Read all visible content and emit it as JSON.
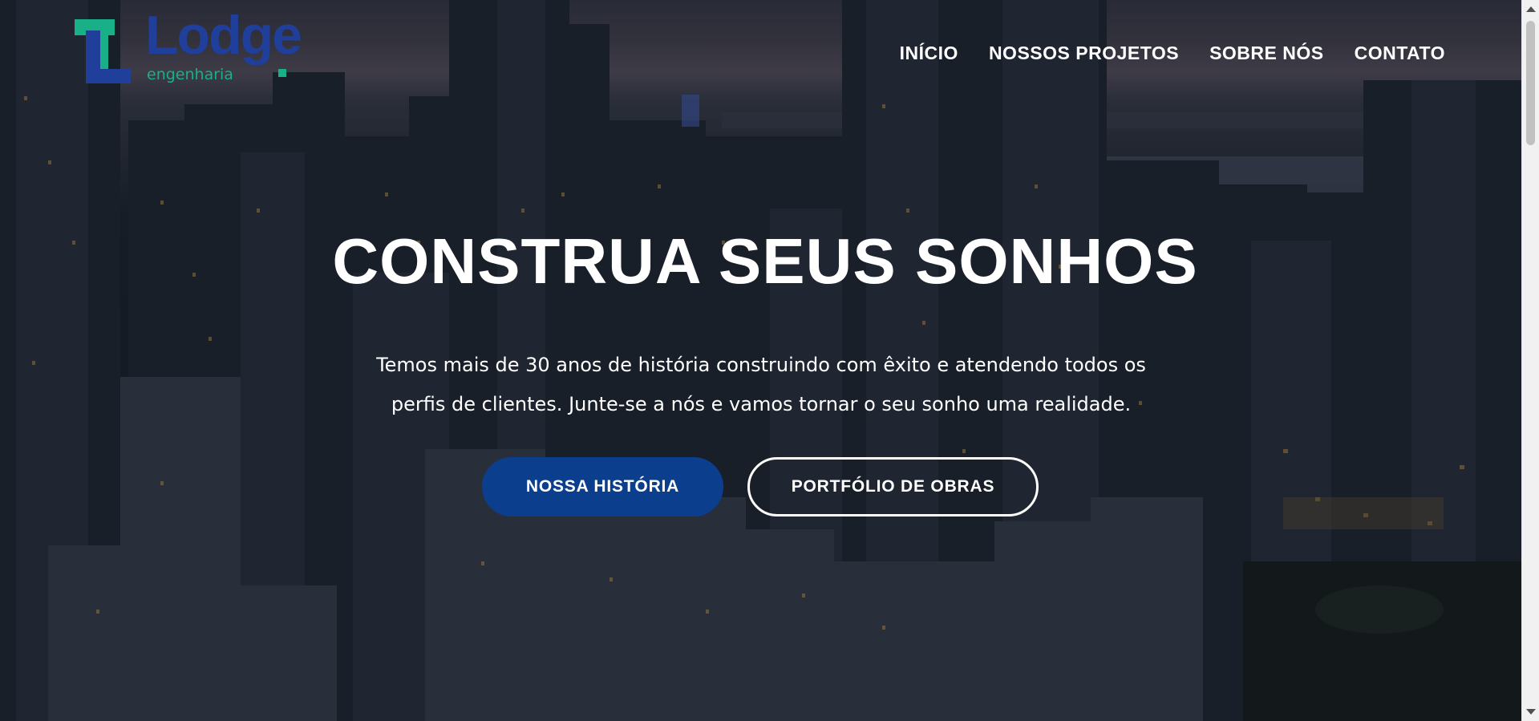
{
  "brand": {
    "name": "Lodge",
    "tagline": "engenharia",
    "colors": {
      "primary": "#1f3f9a",
      "accent": "#19b087"
    }
  },
  "nav": {
    "items": [
      {
        "label": "INÍCIO"
      },
      {
        "label": "NOSSOS PROJETOS"
      },
      {
        "label": "SOBRE NÓS"
      },
      {
        "label": "CONTATO"
      }
    ]
  },
  "hero": {
    "title": "CONSTRUA SEUS SONHOS",
    "text_line1": "Temos mais de 30 anos de história construindo com êxito e atendendo todos os",
    "text_line2": "perfis de clientes. Junte-se a nós e vamos tornar o seu sonho uma realidade.",
    "primary_button": "NOSSA HISTÓRIA",
    "secondary_button": "PORTFÓLIO DE OBRAS",
    "background": "city-skyline-night-image"
  },
  "theme": {
    "button_primary_bg": "#0b3f8e",
    "text_color": "#ffffff"
  }
}
